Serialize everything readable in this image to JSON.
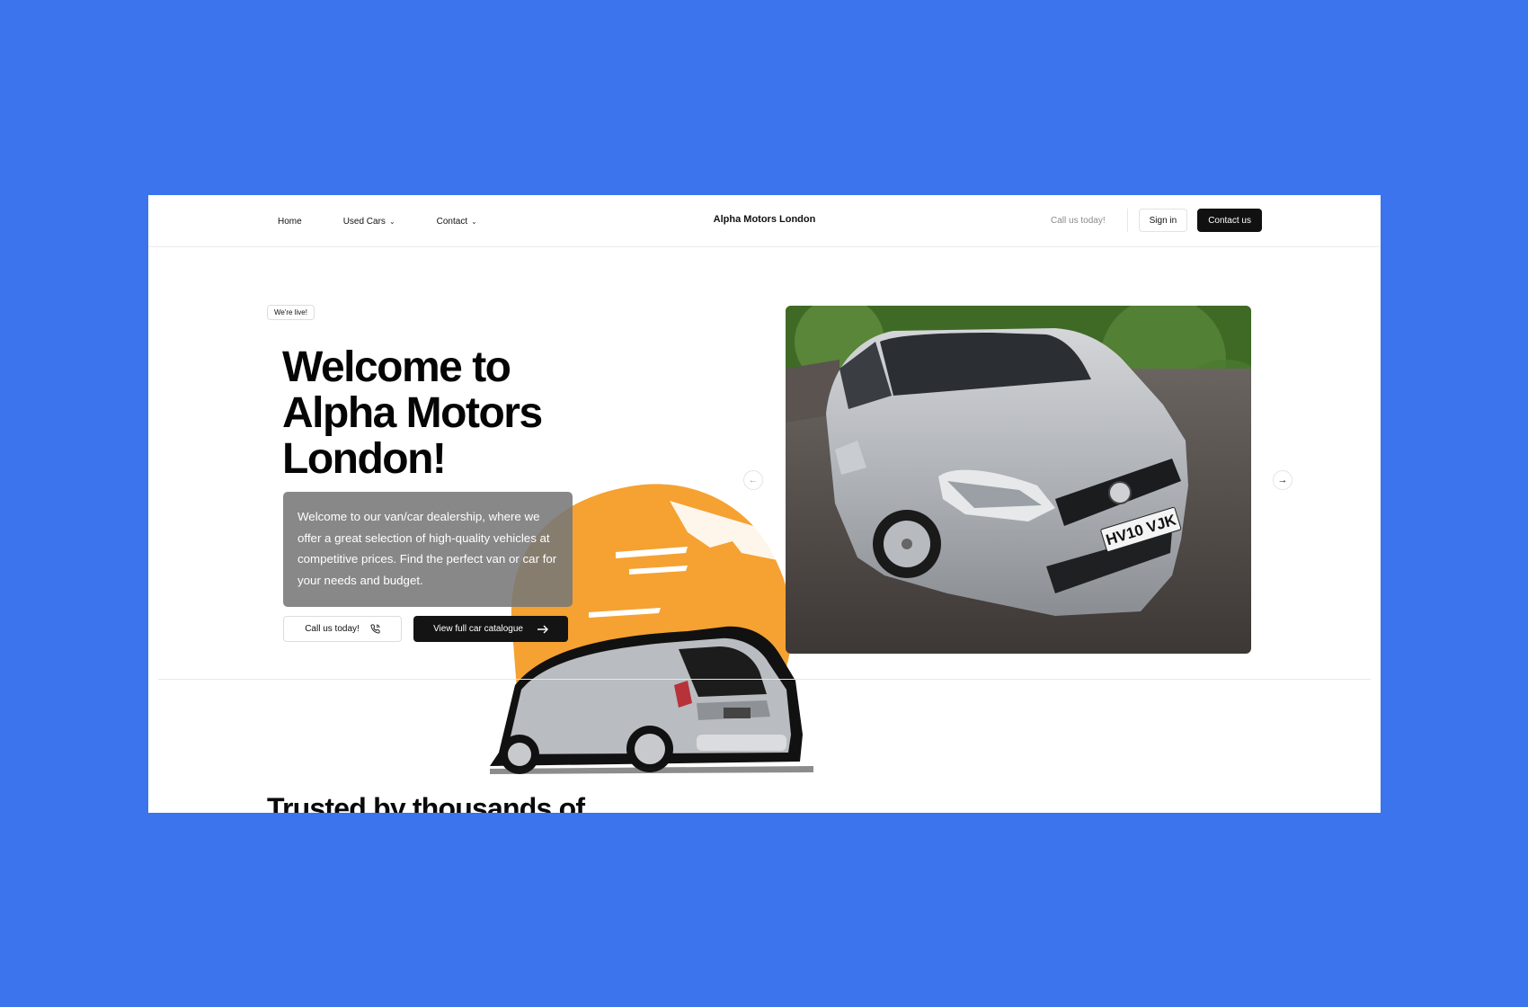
{
  "nav": {
    "links": [
      {
        "label": "Home"
      },
      {
        "label": "Used Cars",
        "dropdown": true
      },
      {
        "label": "Contact",
        "dropdown": true
      }
    ],
    "brand": "Alpha Motors London",
    "call_text": "Call us today!",
    "sign_in": "Sign in",
    "contact_us": "Contact us"
  },
  "hero": {
    "badge": "We're live!",
    "title": "Welcome to Alpha Motors London!",
    "description": "Welcome to our van/car dealership, where we offer a great selection of high-quality vehicles at competitive prices. Find the perfect van or car for your needs and budget.",
    "call_button": "Call us today!",
    "catalogue_button": "View full car catalogue",
    "accent_color": "#f5a232"
  },
  "carousel": {
    "plate": "HV10 VJK",
    "prev_icon": "arrow-left-icon",
    "next_icon": "arrow-right-icon"
  },
  "section": {
    "heading": "Trusted by thousands of"
  }
}
